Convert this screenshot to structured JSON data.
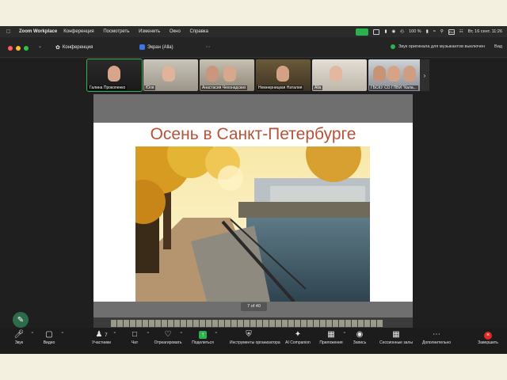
{
  "menubar": {
    "app_name": "Zoom Workplace",
    "menus": [
      "Конференция",
      "Посмотреть",
      "Изменить",
      "Окно",
      "Справка"
    ],
    "battery": "100 %",
    "datetime": "Вт, 16 сент.  11:26",
    "input_lang": "RU"
  },
  "titlebar": {
    "tab_meeting": "Конференция",
    "tab_screen": "Экран (Alla)",
    "original_sound": "Звук оригинала для музыкантов выключен",
    "view_label": "Вид"
  },
  "participants": [
    {
      "name": "Галина Прокопенко",
      "active": true
    },
    {
      "name": "Юля",
      "active": false
    },
    {
      "name": "Анастасия Чехонадских",
      "active": false
    },
    {
      "name": "Немнерницкая Наталия",
      "active": false
    },
    {
      "name": "Alla",
      "active": false
    },
    {
      "name": "ГБСКУ СО ГПВИ \"Кала...",
      "active": false
    }
  ],
  "slide": {
    "title": "Осень в Санкт-Петербурге",
    "counter": "7 of 40"
  },
  "toolbar": [
    {
      "id": "audio",
      "label": "Звук",
      "icon": "mic-icon",
      "chevron": true
    },
    {
      "id": "video",
      "label": "Видео",
      "icon": "video-icon",
      "chevron": true
    },
    {
      "id": "participants",
      "label": "Участники",
      "icon": "participants-icon",
      "badge": "7",
      "chevron": true
    },
    {
      "id": "chat",
      "label": "Чат",
      "icon": "chat-icon",
      "chevron": true
    },
    {
      "id": "react",
      "label": "Отреагировать",
      "icon": "heart-icon",
      "chevron": true
    },
    {
      "id": "share",
      "label": "Поделиться",
      "icon": "share-icon",
      "chevron": true
    },
    {
      "id": "host_tools",
      "label": "Инструменты организатора",
      "icon": "shield-icon"
    },
    {
      "id": "ai",
      "label": "AI Companion",
      "icon": "sparkle-icon"
    },
    {
      "id": "apps",
      "label": "Приложения",
      "icon": "apps-icon",
      "chevron": true
    },
    {
      "id": "record",
      "label": "Запись",
      "icon": "record-icon"
    },
    {
      "id": "breakout",
      "label": "Сессионные залы",
      "icon": "grid-icon"
    },
    {
      "id": "more",
      "label": "Дополнительно",
      "icon": "more-icon"
    },
    {
      "id": "end",
      "label": "Завершить",
      "icon": "end-icon"
    }
  ]
}
